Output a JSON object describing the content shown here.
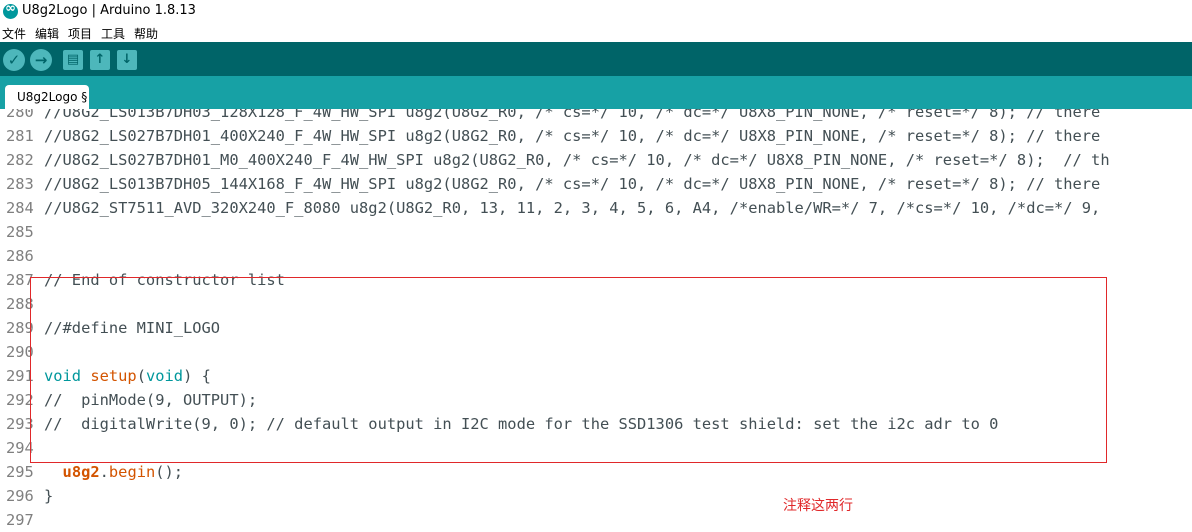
{
  "window": {
    "title": "U8g2Logo | Arduino 1.8.13"
  },
  "menu": [
    "文件",
    "编辑",
    "项目",
    "工具",
    "帮助"
  ],
  "toolbar": {
    "buttons": [
      {
        "name": "verify-button",
        "glyph": "✓"
      },
      {
        "name": "upload-button",
        "glyph": "→"
      },
      {
        "name": "new-button",
        "glyph": "▤"
      },
      {
        "name": "open-button",
        "glyph": "↑"
      },
      {
        "name": "save-button",
        "glyph": "↓"
      }
    ]
  },
  "tabs": [
    {
      "label": "U8g2Logo §"
    }
  ],
  "editor": {
    "lines": [
      {
        "num": "280",
        "segments": [
          {
            "t": "//U8G2_LS013B7DH03_128X128_F_4W_HW_SPI u8g2(U8G2_R0, /* cs=*/ 10, /* dc=*/ U8X8_PIN_NONE, /* reset=*/ 8); // there",
            "c": "comment"
          }
        ]
      },
      {
        "num": "281",
        "segments": [
          {
            "t": "//U8G2_LS027B7DH01_400X240_F_4W_HW_SPI u8g2(U8G2_R0, /* cs=*/ 10, /* dc=*/ U8X8_PIN_NONE, /* reset=*/ 8); // there",
            "c": "comment"
          }
        ]
      },
      {
        "num": "282",
        "segments": [
          {
            "t": "//U8G2_LS027B7DH01_M0_400X240_F_4W_HW_SPI u8g2(U8G2_R0, /* cs=*/ 10, /* dc=*/ U8X8_PIN_NONE, /* reset=*/ 8);  // th",
            "c": "comment"
          }
        ]
      },
      {
        "num": "283",
        "segments": [
          {
            "t": "//U8G2_LS013B7DH05_144X168_F_4W_HW_SPI u8g2(U8G2_R0, /* cs=*/ 10, /* dc=*/ U8X8_PIN_NONE, /* reset=*/ 8); // there",
            "c": "comment"
          }
        ]
      },
      {
        "num": "284",
        "segments": [
          {
            "t": "//U8G2_ST7511_AVD_320X240_F_8080 u8g2(U8G2_R0, 13, 11, 2, 3, 4, 5, 6, A4, /*enable/WR=*/ 7, /*cs=*/ 10, /*dc=*/ 9,",
            "c": "comment"
          }
        ]
      },
      {
        "num": "285",
        "segments": []
      },
      {
        "num": "286",
        "segments": []
      },
      {
        "num": "287",
        "segments": [
          {
            "t": "// End of constructor list",
            "c": "comment"
          }
        ]
      },
      {
        "num": "288",
        "segments": []
      },
      {
        "num": "289",
        "segments": [
          {
            "t": "//#define MINI_LOGO",
            "c": "comment"
          }
        ]
      },
      {
        "num": "290",
        "segments": []
      },
      {
        "num": "291",
        "segments": [
          {
            "t": "void",
            "c": "type"
          },
          {
            "t": " ",
            "c": "plain"
          },
          {
            "t": "setup",
            "c": "func"
          },
          {
            "t": "(",
            "c": "plain"
          },
          {
            "t": "void",
            "c": "type"
          },
          {
            "t": ") {",
            "c": "plain"
          }
        ]
      },
      {
        "num": "292",
        "segments": [
          {
            "t": "//  pinMode(9, OUTPUT);",
            "c": "comment"
          }
        ]
      },
      {
        "num": "293",
        "segments": [
          {
            "t": "//  digitalWrite(9, 0); // default output in I2C mode for the SSD1306 test shield: set the i2c adr to 0",
            "c": "comment"
          }
        ]
      },
      {
        "num": "294",
        "segments": []
      },
      {
        "num": "295",
        "segments": [
          {
            "t": "  ",
            "c": "plain"
          },
          {
            "t": "u8g2",
            "c": "obj"
          },
          {
            "t": ".",
            "c": "plain"
          },
          {
            "t": "begin",
            "c": "func"
          },
          {
            "t": "();",
            "c": "plain"
          }
        ]
      },
      {
        "num": "296",
        "segments": [
          {
            "t": "}",
            "c": "plain"
          }
        ]
      },
      {
        "num": "297",
        "segments": []
      }
    ]
  },
  "annotation": {
    "text": "注释这两行"
  },
  "colors": {
    "toolbar": "#006468",
    "tabbar": "#17a1a5",
    "highlight": "#e0282a"
  }
}
